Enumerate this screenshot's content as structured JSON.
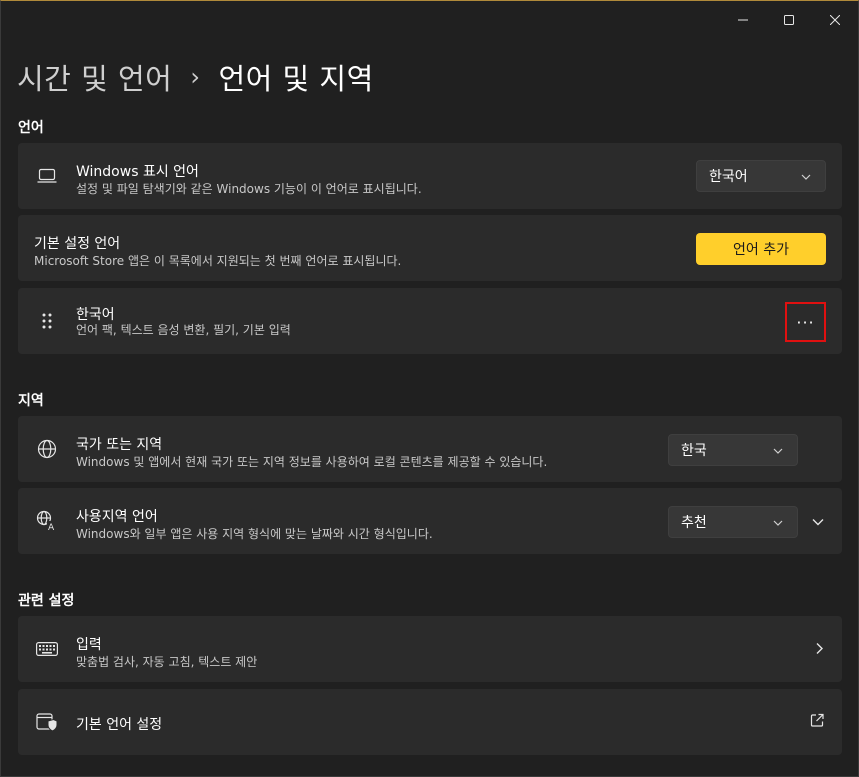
{
  "breadcrumb": {
    "parent": "시간 및 언어",
    "separator": "›",
    "current": "언어 및 지역"
  },
  "sections": {
    "language": "언어",
    "region": "지역",
    "related": "관련 설정"
  },
  "display_language": {
    "title": "Windows 표시 언어",
    "desc": "설정 및 파일 탐색기와 같은 Windows 기능이 이 언어로 표시됩니다.",
    "value": "한국어",
    "icon": "laptop-icon"
  },
  "preferred_languages": {
    "title": "기본 설정 언어",
    "desc": "Microsoft Store 앱은 이 목록에서 지원되는 첫 번째 언어로 표시됩니다.",
    "button": "언어 추가"
  },
  "korean_language": {
    "title": "한국어",
    "desc": "언어 팩, 텍스트 음성 변환, 필기, 기본 입력",
    "more": "···",
    "icon": "drag-handle-icon"
  },
  "country_region": {
    "title": "국가 또는 지역",
    "desc": "Windows 및 앱에서 현재 국가 또는 지역 정보를 사용하여 로컬 콘텐츠를 제공할 수 있습니다.",
    "value": "한국",
    "icon": "globe-icon"
  },
  "regional_format": {
    "title": "사용지역 언어",
    "desc": "Windows와 일부 앱은 사용 지역 형식에 맞는 날짜와 시간 형식입니다.",
    "value": "추천",
    "icon": "language-format-icon"
  },
  "typing": {
    "title": "입력",
    "desc": "맞춤법 검사, 자동 고침, 텍스트 제안",
    "icon": "keyboard-icon"
  },
  "admin_language": {
    "title": "기본 언어 설정",
    "icon": "admin-shield-icon"
  },
  "colors": {
    "accent": "#ffcf2b",
    "card": "#2b2b2b",
    "background": "#202020",
    "highlight": "#e01010"
  }
}
